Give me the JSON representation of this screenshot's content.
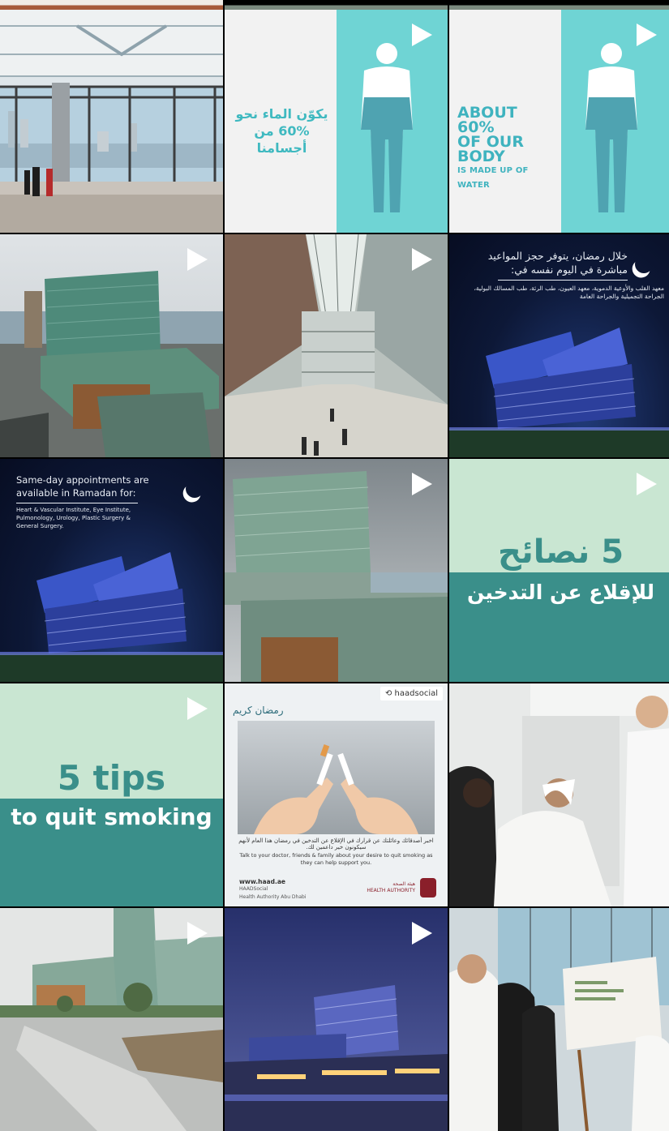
{
  "grid": {
    "tiles": [
      {
        "name": "tile-atrium-window",
        "video": false
      },
      {
        "name": "tile-water-arabic",
        "video": true,
        "text_ar": "يكوّن الماء نحو %60 من أجسامنا"
      },
      {
        "name": "tile-water-english",
        "video": true,
        "line1": "ABOUT 60%",
        "line2": "OF OUR BODY",
        "line3": "IS MADE UP OF WATER"
      },
      {
        "name": "tile-hospital-aerial",
        "video": true
      },
      {
        "name": "tile-atrium-interior",
        "video": true
      },
      {
        "name": "tile-ramadan-arabic",
        "video": false,
        "heading": "خلال رمضان، يتوفر حجز المواعيد مباشرة في اليوم نفسه في:",
        "body": "معهد القلب والأوعية الدموية، معهد العيون، طب الرئة، طب المسالك البولية، الجراحة التجميلية والجراحة العامة"
      },
      {
        "name": "tile-ramadan-english",
        "video": false,
        "heading": "Same-day appointments are available in Ramadan for:",
        "body": "Heart & Vascular Institute, Eye Institute, Pulmonology, Urology, Plastic Surgery & General Surgery."
      },
      {
        "name": "tile-hospital-facade",
        "video": true
      },
      {
        "name": "tile-tips-arabic",
        "video": true,
        "big": "5 نصائح",
        "small": "للإقلاع عن التدخين"
      },
      {
        "name": "tile-tips-english",
        "video": true,
        "big": "5 tips",
        "small": "to quit smoking"
      },
      {
        "name": "tile-haad-repost",
        "video": false,
        "repost": "haadsocial",
        "greeting": "رمضان كريم",
        "caption_ar": "اخبر أصدقائك وعائلتك عن قرارك في الإقلاع عن التدخين في رمضان هذا العام لأنهم سيكونون خير داعمين لك.",
        "caption_en": "Talk to your doctor, friends & family about your desire to quit smoking as they can help support you.",
        "url": "www.haad.ae",
        "social": "HAADSocial",
        "org": "Health Authority Abu Dhabi",
        "authority_ar": "هيئة الصحة",
        "authority_en": "HEALTH AUTHORITY"
      },
      {
        "name": "tile-clinic-visit",
        "video": false
      },
      {
        "name": "tile-hospital-street",
        "video": true
      },
      {
        "name": "tile-hospital-night",
        "video": true
      },
      {
        "name": "tile-exhibit-visit",
        "video": false
      }
    ]
  }
}
